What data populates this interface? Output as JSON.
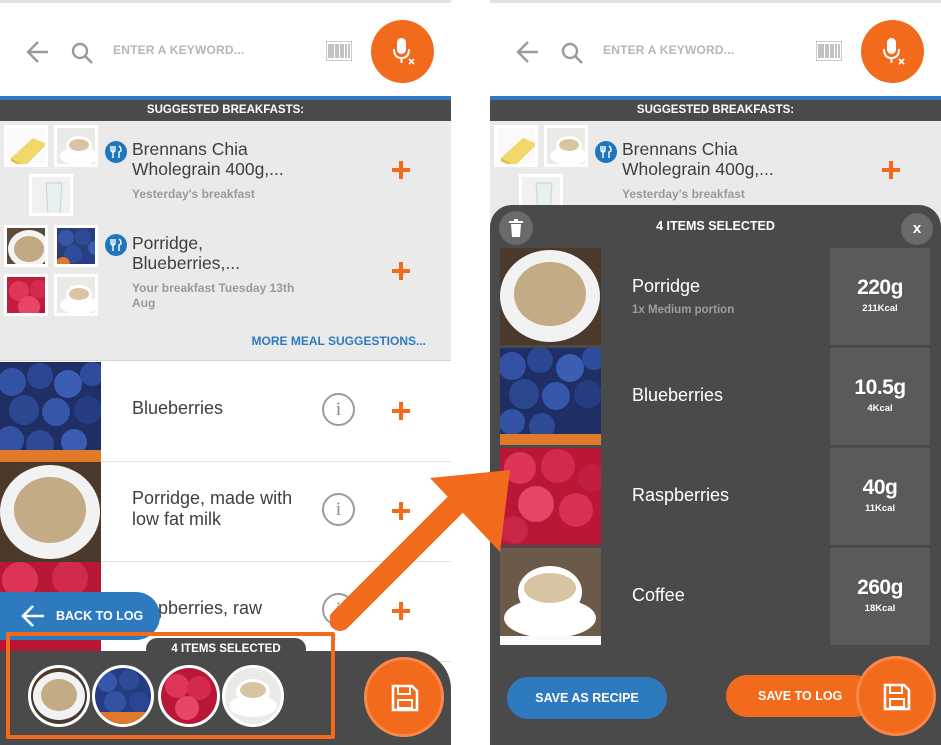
{
  "search": {
    "placeholder": "ENTER A KEYWORD..."
  },
  "suggestions": {
    "header": "SUGGESTED BREAKFASTS:",
    "items": [
      {
        "title": "Brennans Chia Wholegrain 400g,...",
        "subtitle": "Yesterday's breakfast"
      },
      {
        "title": "Porridge, Blueberries,...",
        "subtitle": "Your breakfast Tuesday 13th Aug"
      }
    ],
    "more": "MORE MEAL SUGGESTIONS..."
  },
  "results": [
    {
      "name": "Blueberries"
    },
    {
      "name": "Porridge, made with low fat milk"
    },
    {
      "name": "Raspberries, raw",
      "visible_text": "pberries, raw"
    }
  ],
  "info_glyph": "i",
  "back_to_log": "BACK TO LOG",
  "tray": {
    "label": "4 ITEMS SELECTED"
  },
  "selected": {
    "title": "4 ITEMS SELECTED",
    "close": "x",
    "items": [
      {
        "name": "Porridge",
        "portion": "1x Medium portion",
        "qty": "220g",
        "kcal": "211Kcal"
      },
      {
        "name": "Blueberries",
        "portion": "",
        "qty": "10.5g",
        "kcal": "4Kcal"
      },
      {
        "name": "Raspberries",
        "portion": "",
        "qty": "40g",
        "kcal": "11Kcal"
      },
      {
        "name": "Coffee",
        "portion": "",
        "qty": "260g",
        "kcal": "18Kcal"
      }
    ]
  },
  "actions": {
    "save_recipe": "SAVE AS RECIPE",
    "save_log": "SAVE TO LOG"
  },
  "icons": [
    "back-arrow-icon",
    "search-icon",
    "barcode-icon",
    "microphone-icon",
    "cutlery-icon",
    "plus-icon",
    "info-icon",
    "save-disk-icon",
    "trash-icon",
    "close-icon"
  ],
  "colors": {
    "accent": "#f26a1b",
    "blue": "#2e7abf",
    "dark": "#4a4a4a"
  }
}
